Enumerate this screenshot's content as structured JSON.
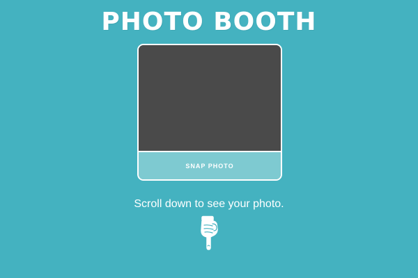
{
  "header": {
    "title": "PHOTO BOOTH"
  },
  "booth": {
    "snap_label": "SNAP PHOTO"
  },
  "hint": {
    "text": "Scroll down to see your photo.",
    "icon": "pointing-down-hand-icon"
  },
  "colors": {
    "background": "#44b2c0",
    "viewfinder": "#4a4a4a",
    "button": "#7ecad1",
    "text": "#ffffff"
  }
}
